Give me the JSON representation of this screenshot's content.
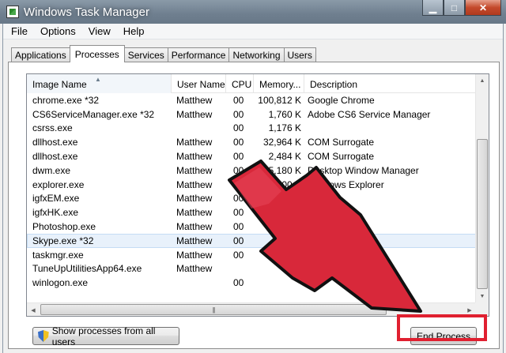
{
  "window": {
    "title": "Windows Task Manager",
    "minimize_glyph": "▁",
    "maximize_glyph": "□",
    "close_glyph": "✕"
  },
  "menu": [
    "File",
    "Options",
    "View",
    "Help"
  ],
  "tabs": [
    "Applications",
    "Processes",
    "Services",
    "Performance",
    "Networking",
    "Users"
  ],
  "active_tab": "Processes",
  "columns": {
    "name": "Image Name",
    "user": "User Name",
    "cpu": "CPU",
    "memory": "Memory...",
    "description": "Description"
  },
  "sort_indicator": "▲",
  "processes": [
    {
      "name": "chrome.exe *32",
      "user": "Matthew",
      "cpu": "00",
      "memory": "100,812 K",
      "description": "Google Chrome"
    },
    {
      "name": "CS6ServiceManager.exe *32",
      "user": "Matthew",
      "cpu": "00",
      "memory": "1,760 K",
      "description": "Adobe CS6 Service Manager"
    },
    {
      "name": "csrss.exe",
      "user": "",
      "cpu": "00",
      "memory": "1,176 K",
      "description": ""
    },
    {
      "name": "dllhost.exe",
      "user": "Matthew",
      "cpu": "00",
      "memory": "32,964 K",
      "description": "COM Surrogate"
    },
    {
      "name": "dllhost.exe",
      "user": "Matthew",
      "cpu": "00",
      "memory": "2,484 K",
      "description": "COM Surrogate"
    },
    {
      "name": "dwm.exe",
      "user": "Matthew",
      "cpu": "00",
      "memory": "15,180 K",
      "description": "Desktop Window Manager"
    },
    {
      "name": "explorer.exe",
      "user": "Matthew",
      "cpu": "00",
      "memory": "900 K",
      "description": "Windows Explorer"
    },
    {
      "name": "igfxEM.exe",
      "user": "Matthew",
      "cpu": "00",
      "memory": "",
      "description": "dule"
    },
    {
      "name": "igfxHK.exe",
      "user": "Matthew",
      "cpu": "00",
      "memory": "",
      "description": "dule"
    },
    {
      "name": "Photoshop.exe",
      "user": "Matthew",
      "cpu": "00",
      "memory": "58",
      "description": "hop CS6"
    },
    {
      "name": "Skype.exe *32",
      "user": "Matthew",
      "cpu": "00",
      "memory": "75",
      "description": ""
    },
    {
      "name": "taskmgr.exe",
      "user": "Matthew",
      "cpu": "00",
      "memory": "",
      "description": "Manager"
    },
    {
      "name": "TuneUpUtilitiesApp64.exe",
      "user": "Matthew",
      "cpu": "",
      "memory": "",
      "description": ""
    },
    {
      "name": "winlogon.exe",
      "user": "",
      "cpu": "00",
      "memory": "",
      "description": ""
    }
  ],
  "selected_process": "Skype.exe *32",
  "buttons": {
    "show_all": "Show processes from all users",
    "end_process": "End Process"
  },
  "scroll_grip": "|||",
  "annotation_color": "#e02030"
}
